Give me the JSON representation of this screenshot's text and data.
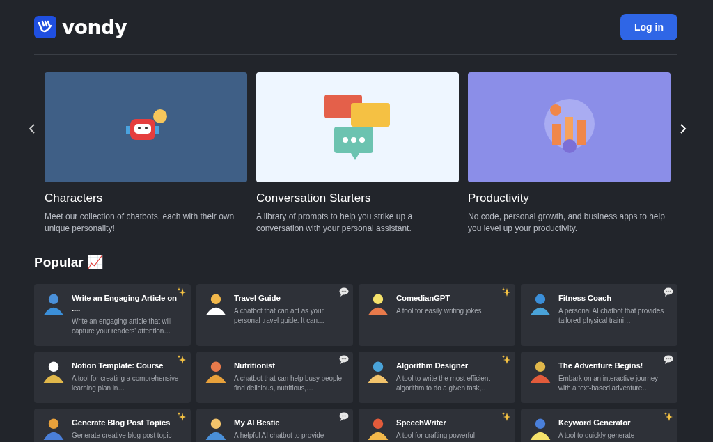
{
  "header": {
    "logo": "vondy",
    "login_button": "Log in"
  },
  "categories": [
    {
      "title": "Characters",
      "description": "Meet our collection of chatbots, each with their own unique personality!",
      "color": "#3f5f86"
    },
    {
      "title": "Conversation Starters",
      "description": "A library of prompts to help you strike up a conversation with your personal assistant.",
      "color": "#eef6ff"
    },
    {
      "title": "Productivity",
      "description": "No code, personal growth, and business apps to help you level up your productivity.",
      "color": "#8b8ee8"
    }
  ],
  "popular": {
    "title": "Popular 📈",
    "items": [
      {
        "kind": "tool",
        "title": "Write an Engaging Article on ....",
        "description": "Write an engaging article that will capture your readers' attention…"
      },
      {
        "kind": "chat",
        "title": "Travel Guide",
        "description": "A chatbot that can act as your personal travel guide. It can…"
      },
      {
        "kind": "tool",
        "title": "ComedianGPT",
        "description": "A tool for easily writing jokes"
      },
      {
        "kind": "chat",
        "title": "Fitness Coach",
        "description": "A personal AI chatbot that provides tailored physical traini…"
      },
      {
        "kind": "tool",
        "title": "Notion Template: Course",
        "description": "A tool for creating a comprehensive learning plan in…"
      },
      {
        "kind": "chat",
        "title": "Nutritionist",
        "description": "A chatbot that can help busy people find delicious, nutritious,…"
      },
      {
        "kind": "tool",
        "title": "Algorithm Designer",
        "description": "A tool to write the most efficient algorithm to do a given task,…"
      },
      {
        "kind": "chat",
        "title": "The Adventure Begins!",
        "description": "Embark on an interactive journey with a text-based adventure…"
      },
      {
        "kind": "tool",
        "title": "Generate Blog Post Topics",
        "description": "Generate creative blog post topic"
      },
      {
        "kind": "chat",
        "title": "My AI Bestie",
        "description": "A helpful AI chatbot to provide"
      },
      {
        "kind": "tool",
        "title": "SpeechWriter",
        "description": "A tool for crafting powerful"
      },
      {
        "kind": "tool",
        "title": "Keyword Generator",
        "description": "A tool to quickly generate"
      }
    ]
  }
}
